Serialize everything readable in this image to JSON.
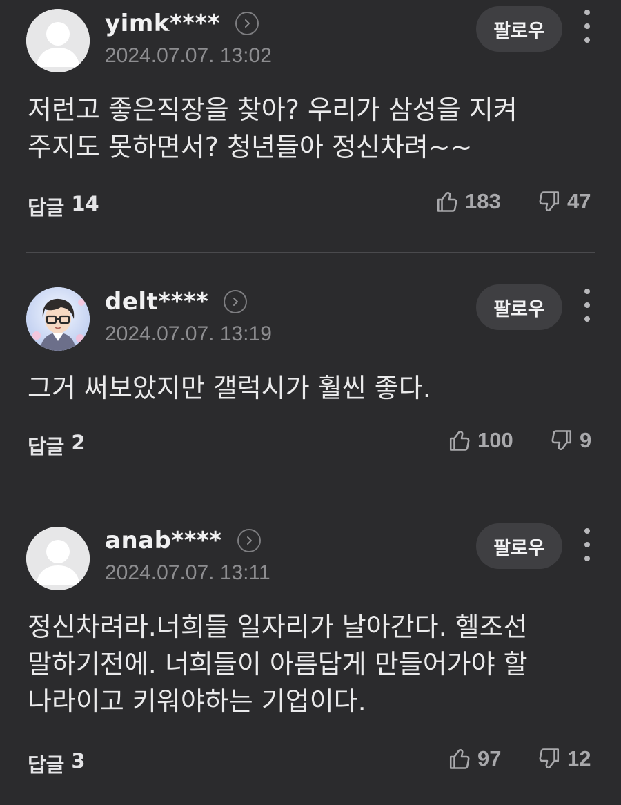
{
  "comments": [
    {
      "username": "yimk****",
      "timestamp": "2024.07.07. 13:02",
      "follow_label": "팔로우",
      "body": "저런고 좋은직장을 찾아? 우리가 삼성을 지켜\n주지도 못하면서? 청년들아 정신차려~~",
      "reply_label": "답글",
      "reply_count": "14",
      "like_count": "183",
      "dislike_count": "47",
      "avatar": "default-avatar"
    },
    {
      "username": "delt****",
      "timestamp": "2024.07.07. 13:19",
      "follow_label": "팔로우",
      "body": "그거 써보았지만 갤럭시가 훨씬 좋다.",
      "reply_label": "답글",
      "reply_count": "2",
      "like_count": "100",
      "dislike_count": "9",
      "avatar": "cartoon-avatar"
    },
    {
      "username": "anab****",
      "timestamp": "2024.07.07. 13:11",
      "follow_label": "팔로우",
      "body": "정신차려라.너희들 일자리가 날아간다. 헬조선\n말하기전에. 너희들이 아름답게 만들어가야 할\n나라이고 키워야하는 기업이다.",
      "reply_label": "답글",
      "reply_count": "3",
      "like_count": "97",
      "dislike_count": "12",
      "avatar": "default-avatar"
    }
  ],
  "icons": {
    "profile_arrow": "chevron-right-icon",
    "like": "thumbs-up-icon",
    "dislike": "thumbs-down-icon",
    "more": "more-vertical-icon"
  },
  "colors": {
    "background": "#2b2b2d",
    "follow_button": "#3f3f42",
    "meta_text": "#8d8d90"
  }
}
